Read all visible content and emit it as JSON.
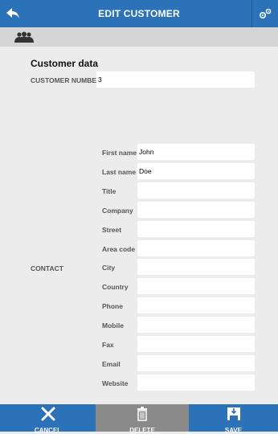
{
  "header": {
    "title": "EDIT CUSTOMER",
    "back_icon": "back-arrow-icon",
    "settings_icon": "gears-icon"
  },
  "subheader": {
    "icon": "people-icon"
  },
  "section": {
    "title": "Customer data",
    "customer_number_label": "CUSTOMER NUMBER",
    "customer_number_value": "3",
    "contact_group_label": "CONTACT"
  },
  "contact": {
    "fields": [
      {
        "label": "First name",
        "value": "John"
      },
      {
        "label": "Last name",
        "value": "Doe"
      },
      {
        "label": "Title",
        "value": ""
      },
      {
        "label": "Company",
        "value": ""
      },
      {
        "label": "Street",
        "value": ""
      },
      {
        "label": "Area code",
        "value": ""
      },
      {
        "label": "City",
        "value": ""
      },
      {
        "label": "Country",
        "value": ""
      },
      {
        "label": "Phone",
        "value": ""
      },
      {
        "label": "Mobile",
        "value": ""
      },
      {
        "label": "Fax",
        "value": ""
      },
      {
        "label": "Email",
        "value": ""
      },
      {
        "label": "Website",
        "value": ""
      }
    ]
  },
  "footer": {
    "cancel_label": "CANCEL",
    "delete_label": "DELETE",
    "save_label": "SAVE",
    "colors": {
      "primary": "#2b72b9",
      "disabled": "#8a8a8a"
    }
  }
}
